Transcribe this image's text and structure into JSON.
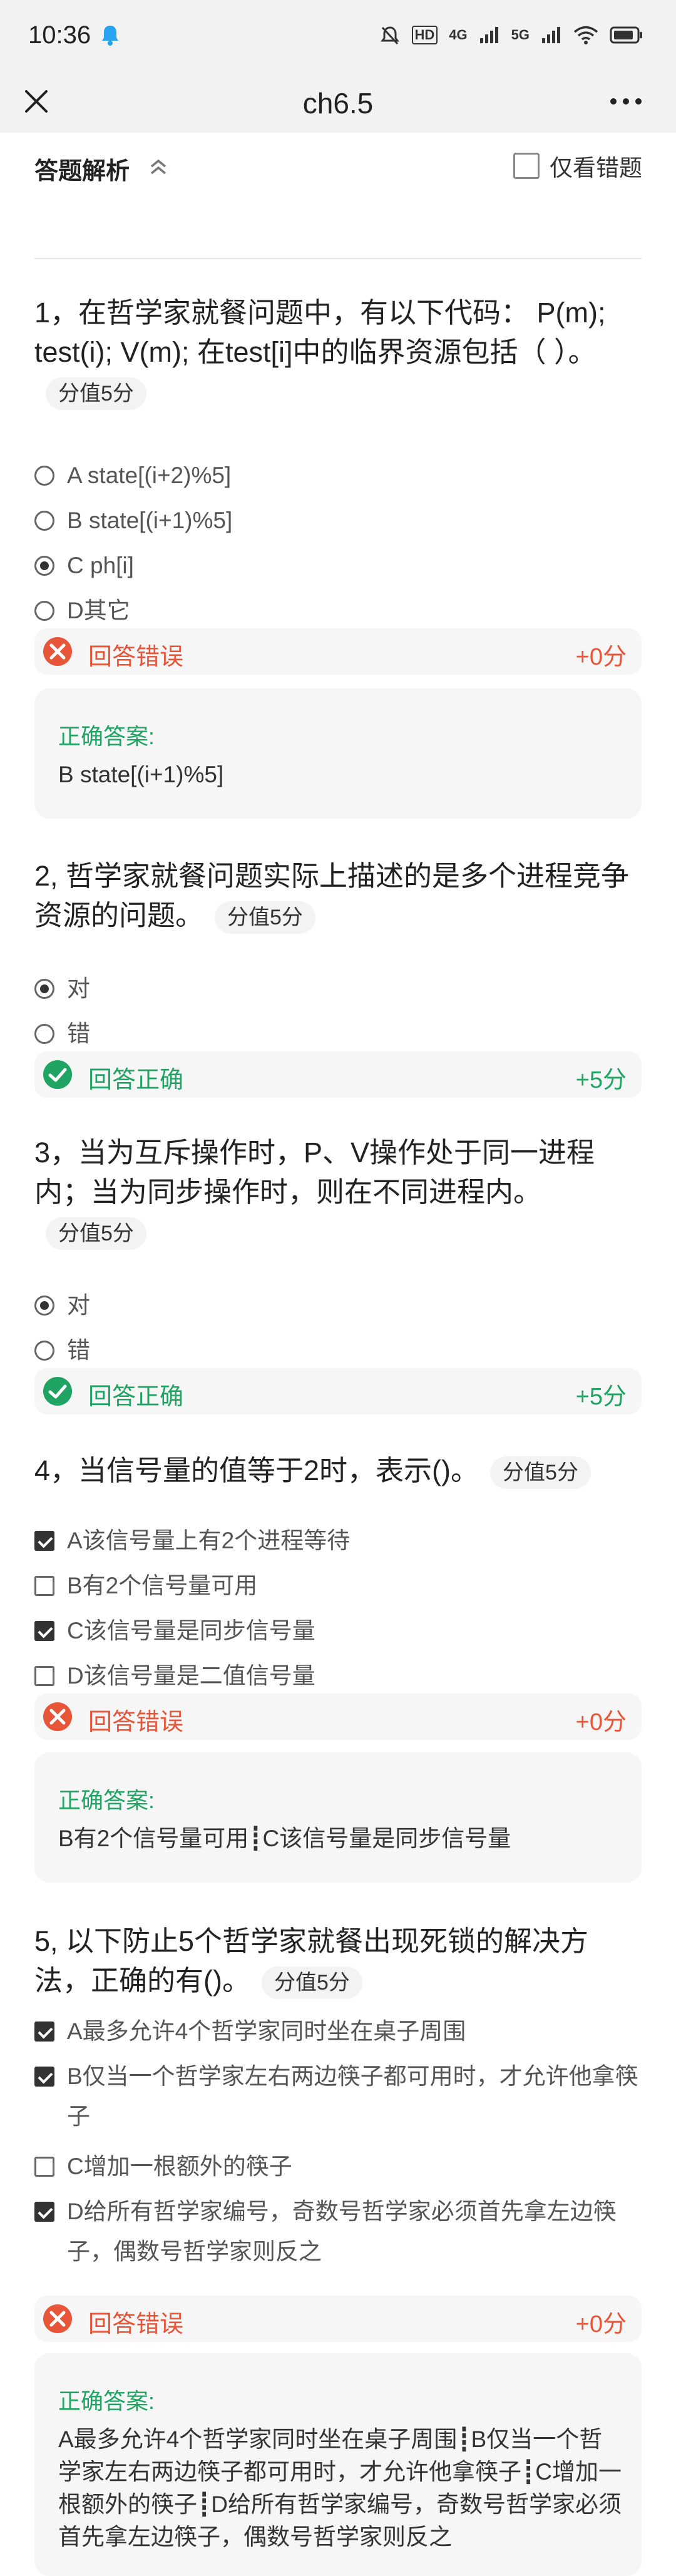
{
  "status_bar": {
    "time": "10:36",
    "icons": [
      "mute-icon",
      "hd-icon",
      "4g-signal-icon",
      "5g-signal-icon",
      "wifi-icon",
      "battery-icon"
    ],
    "hd": "HD",
    "net1": "4G",
    "net2": "5G"
  },
  "nav": {
    "title": "ch6.5"
  },
  "analysis": {
    "title": "答题解析",
    "wrong_only_label": "仅看错题"
  },
  "colors": {
    "wrong": "#e8563a",
    "right": "#1fa463",
    "background": "#ffffff"
  },
  "questions": [
    {
      "text": "1，在哲学家就餐问题中，有以下代码： P(m); test(i); V(m); 在test[i]中的临界资源包括（ ）。",
      "score_tag": "分值5分",
      "type": "radio",
      "options": [
        {
          "label": "A state[(i+2)%5]",
          "selected": false
        },
        {
          "label": "B state[(i+1)%5]",
          "selected": false
        },
        {
          "label": "C ph[i]",
          "selected": true
        },
        {
          "label": "D其它",
          "selected": false
        }
      ],
      "result": {
        "status": "wrong",
        "label": "回答错误",
        "score": "+0分"
      },
      "answer": {
        "label": "正确答案:",
        "text": "B state[(i+1)%5]"
      }
    },
    {
      "text": "2, 哲学家就餐问题实际上描述的是多个进程竞争资源的问题。",
      "score_tag": "分值5分",
      "type": "radio",
      "options": [
        {
          "label": "对",
          "selected": true
        },
        {
          "label": "错",
          "selected": false
        }
      ],
      "result": {
        "status": "right",
        "label": "回答正确",
        "score": "+5分"
      }
    },
    {
      "text": "3，当为互斥操作时，P、V操作处于同一进程内；当为同步操作时，则在不同进程内。",
      "score_tag": "分值5分",
      "type": "radio",
      "options": [
        {
          "label": "对",
          "selected": true
        },
        {
          "label": "错",
          "selected": false
        }
      ],
      "result": {
        "status": "right",
        "label": "回答正确",
        "score": "+5分"
      }
    },
    {
      "text": "4，当信号量的值等于2时，表示()。",
      "score_tag": "分值5分",
      "type": "checkbox",
      "options": [
        {
          "label": "A该信号量上有2个进程等待",
          "selected": true
        },
        {
          "label": "B有2个信号量可用",
          "selected": false
        },
        {
          "label": "C该信号量是同步信号量",
          "selected": true
        },
        {
          "label": "D该信号量是二值信号量",
          "selected": false
        }
      ],
      "result": {
        "status": "wrong",
        "label": "回答错误",
        "score": "+0分"
      },
      "answer": {
        "label": "正确答案:",
        "text": "B有2个信号量可用┋C该信号量是同步信号量"
      }
    },
    {
      "text": "5, 以下防止5个哲学家就餐出现死锁的解决方法，正确的有()。",
      "score_tag": "分值5分",
      "type": "checkbox",
      "options": [
        {
          "label": "A最多允许4个哲学家同时坐在桌子周围",
          "selected": true
        },
        {
          "label": "B仅当一个哲学家左右两边筷子都可用时，才允许他拿筷子",
          "selected": true
        },
        {
          "label": "C增加一根额外的筷子",
          "selected": false
        },
        {
          "label": "D给所有哲学家编号，奇数号哲学家必须首先拿左边筷子，偶数号哲学家则反之",
          "selected": true
        }
      ],
      "result": {
        "status": "wrong",
        "label": "回答错误",
        "score": "+0分"
      },
      "answer": {
        "label": "正确答案:",
        "text": "A最多允许4个哲学家同时坐在桌子周围┋B仅当一个哲学家左右两边筷子都可用时，才允许他拿筷子┋C增加一根额外的筷子┋D给所有哲学家编号，奇数号哲学家必须首先拿左边筷子，偶数号哲学家则反之"
      }
    }
  ]
}
